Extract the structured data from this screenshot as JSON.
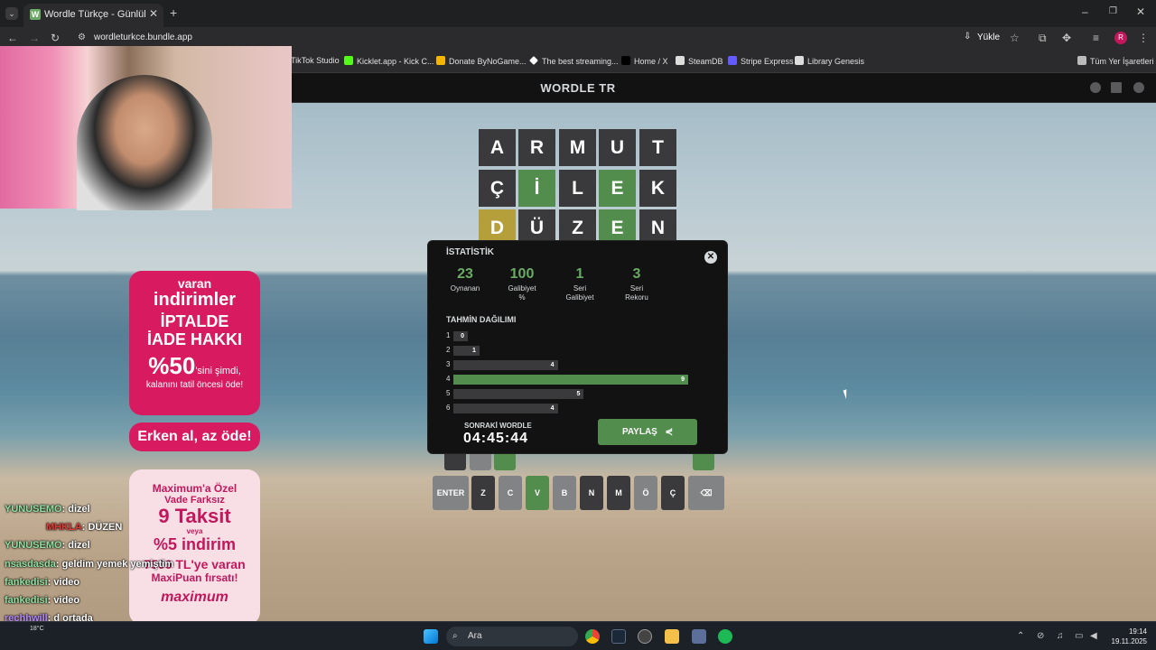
{
  "browser": {
    "tab_title": "Wordle Türkçe - Günlük Kelime",
    "tab_favicon": "W",
    "url": "wordleturkce.bundle.app",
    "install_label": "Yükle",
    "profile_letter": "R"
  },
  "bookmarks": [
    {
      "label": "TikTok Studio",
      "icon": "tiktok-icon"
    },
    {
      "label": "Kicklet.app - Kick C...",
      "icon": "kicklet-icon"
    },
    {
      "label": "Donate ByNoGame...",
      "icon": "bynogame-icon"
    },
    {
      "label": "The best streaming...",
      "icon": "diamond-icon"
    },
    {
      "label": "Home / X",
      "icon": "x-icon"
    },
    {
      "label": "SteamDB",
      "icon": "steamdb-icon"
    },
    {
      "label": "Stripe Express",
      "icon": "stripe-icon"
    },
    {
      "label": "Library Genesis",
      "icon": "book-icon"
    }
  ],
  "all_bookmarks_label": "Tüm Yer İşaretleri",
  "app": {
    "title": "WORDLE TR",
    "board": [
      [
        {
          "l": "A",
          "s": "absent"
        },
        {
          "l": "R",
          "s": "absent"
        },
        {
          "l": "M",
          "s": "absent"
        },
        {
          "l": "U",
          "s": "absent"
        },
        {
          "l": "T",
          "s": "absent"
        }
      ],
      [
        {
          "l": "Ç",
          "s": "absent"
        },
        {
          "l": "İ",
          "s": "correct"
        },
        {
          "l": "L",
          "s": "absent"
        },
        {
          "l": "E",
          "s": "correct"
        },
        {
          "l": "K",
          "s": "absent"
        }
      ],
      [
        {
          "l": "D",
          "s": "present"
        },
        {
          "l": "Ü",
          "s": "absent"
        },
        {
          "l": "Z",
          "s": "absent"
        },
        {
          "l": "E",
          "s": "correct"
        },
        {
          "l": "N",
          "s": "absent"
        }
      ]
    ],
    "keyboard_bottom": [
      "ENTER",
      "Z",
      "C",
      "V",
      "B",
      "N",
      "M",
      "Ö",
      "Ç",
      "⌫"
    ]
  },
  "stats": {
    "title": "İSTATİSTİK",
    "items": [
      {
        "value": "23",
        "label": "Oynanan"
      },
      {
        "value": "100",
        "label": "Galibiyet %"
      },
      {
        "value": "1",
        "label": "Seri Galibiyet"
      },
      {
        "value": "3",
        "label": "Seri Rekoru"
      }
    ],
    "distribution_title": "TAHMİN DAĞILIMI",
    "distribution": [
      {
        "guess": "1",
        "count": 0
      },
      {
        "guess": "2",
        "count": 1
      },
      {
        "guess": "3",
        "count": 4
      },
      {
        "guess": "4",
        "count": 9
      },
      {
        "guess": "5",
        "count": 5
      },
      {
        "guess": "6",
        "count": 4
      }
    ],
    "highlight_guess": "4",
    "next_label": "SONRAKİ WORDLE",
    "countdown": "04:45:44",
    "share_label": "PAYLAŞ"
  },
  "ad": {
    "line1": "varan",
    "line2": "indirimler",
    "line3": "İPTALDE",
    "line4": "İADE HAKKI",
    "line5": "%50",
    "line5b": "'sini şimdi,",
    "line6": "kalanını tatil öncesi öde!",
    "cta": "Erken al, az öde!",
    "card2_l1": "Maximum'a Özel",
    "card2_l2": "Vade Farksız",
    "card2_l3": "9 Taksit",
    "card2_l4": "veya",
    "card2_l5": "%5 indirim",
    "card2_l6": "7500 TL'ye varan",
    "card2_l7": "MaxiPuan fırsatı!",
    "brand": "maximum"
  },
  "chat": [
    {
      "user": "YUNUSEMO",
      "msg": ": dizel"
    },
    {
      "user": "MHKLA",
      "msg": ": DÜZEN"
    },
    {
      "user": "YUNUSEMO",
      "msg": ": dizel"
    },
    {
      "user": "nsasdasda",
      "msg": ": geldim yemek yemiştim"
    },
    {
      "user": "fankedisi",
      "msg": ": video"
    },
    {
      "user": "fankedisi",
      "msg": ": video"
    },
    {
      "user": "rechhwill",
      "msg": ": d ortada"
    },
    {
      "user": "fankedisi",
      "msg": ": video"
    }
  ],
  "taskbar": {
    "search_label": "Ara",
    "weather": "18°C",
    "time": "19:14",
    "date": "19.11.2025"
  },
  "colors": {
    "correct": "#538d4e",
    "present": "#b59f3b",
    "absent": "#3a3a3c",
    "stat_accent": "#6aaa64"
  }
}
